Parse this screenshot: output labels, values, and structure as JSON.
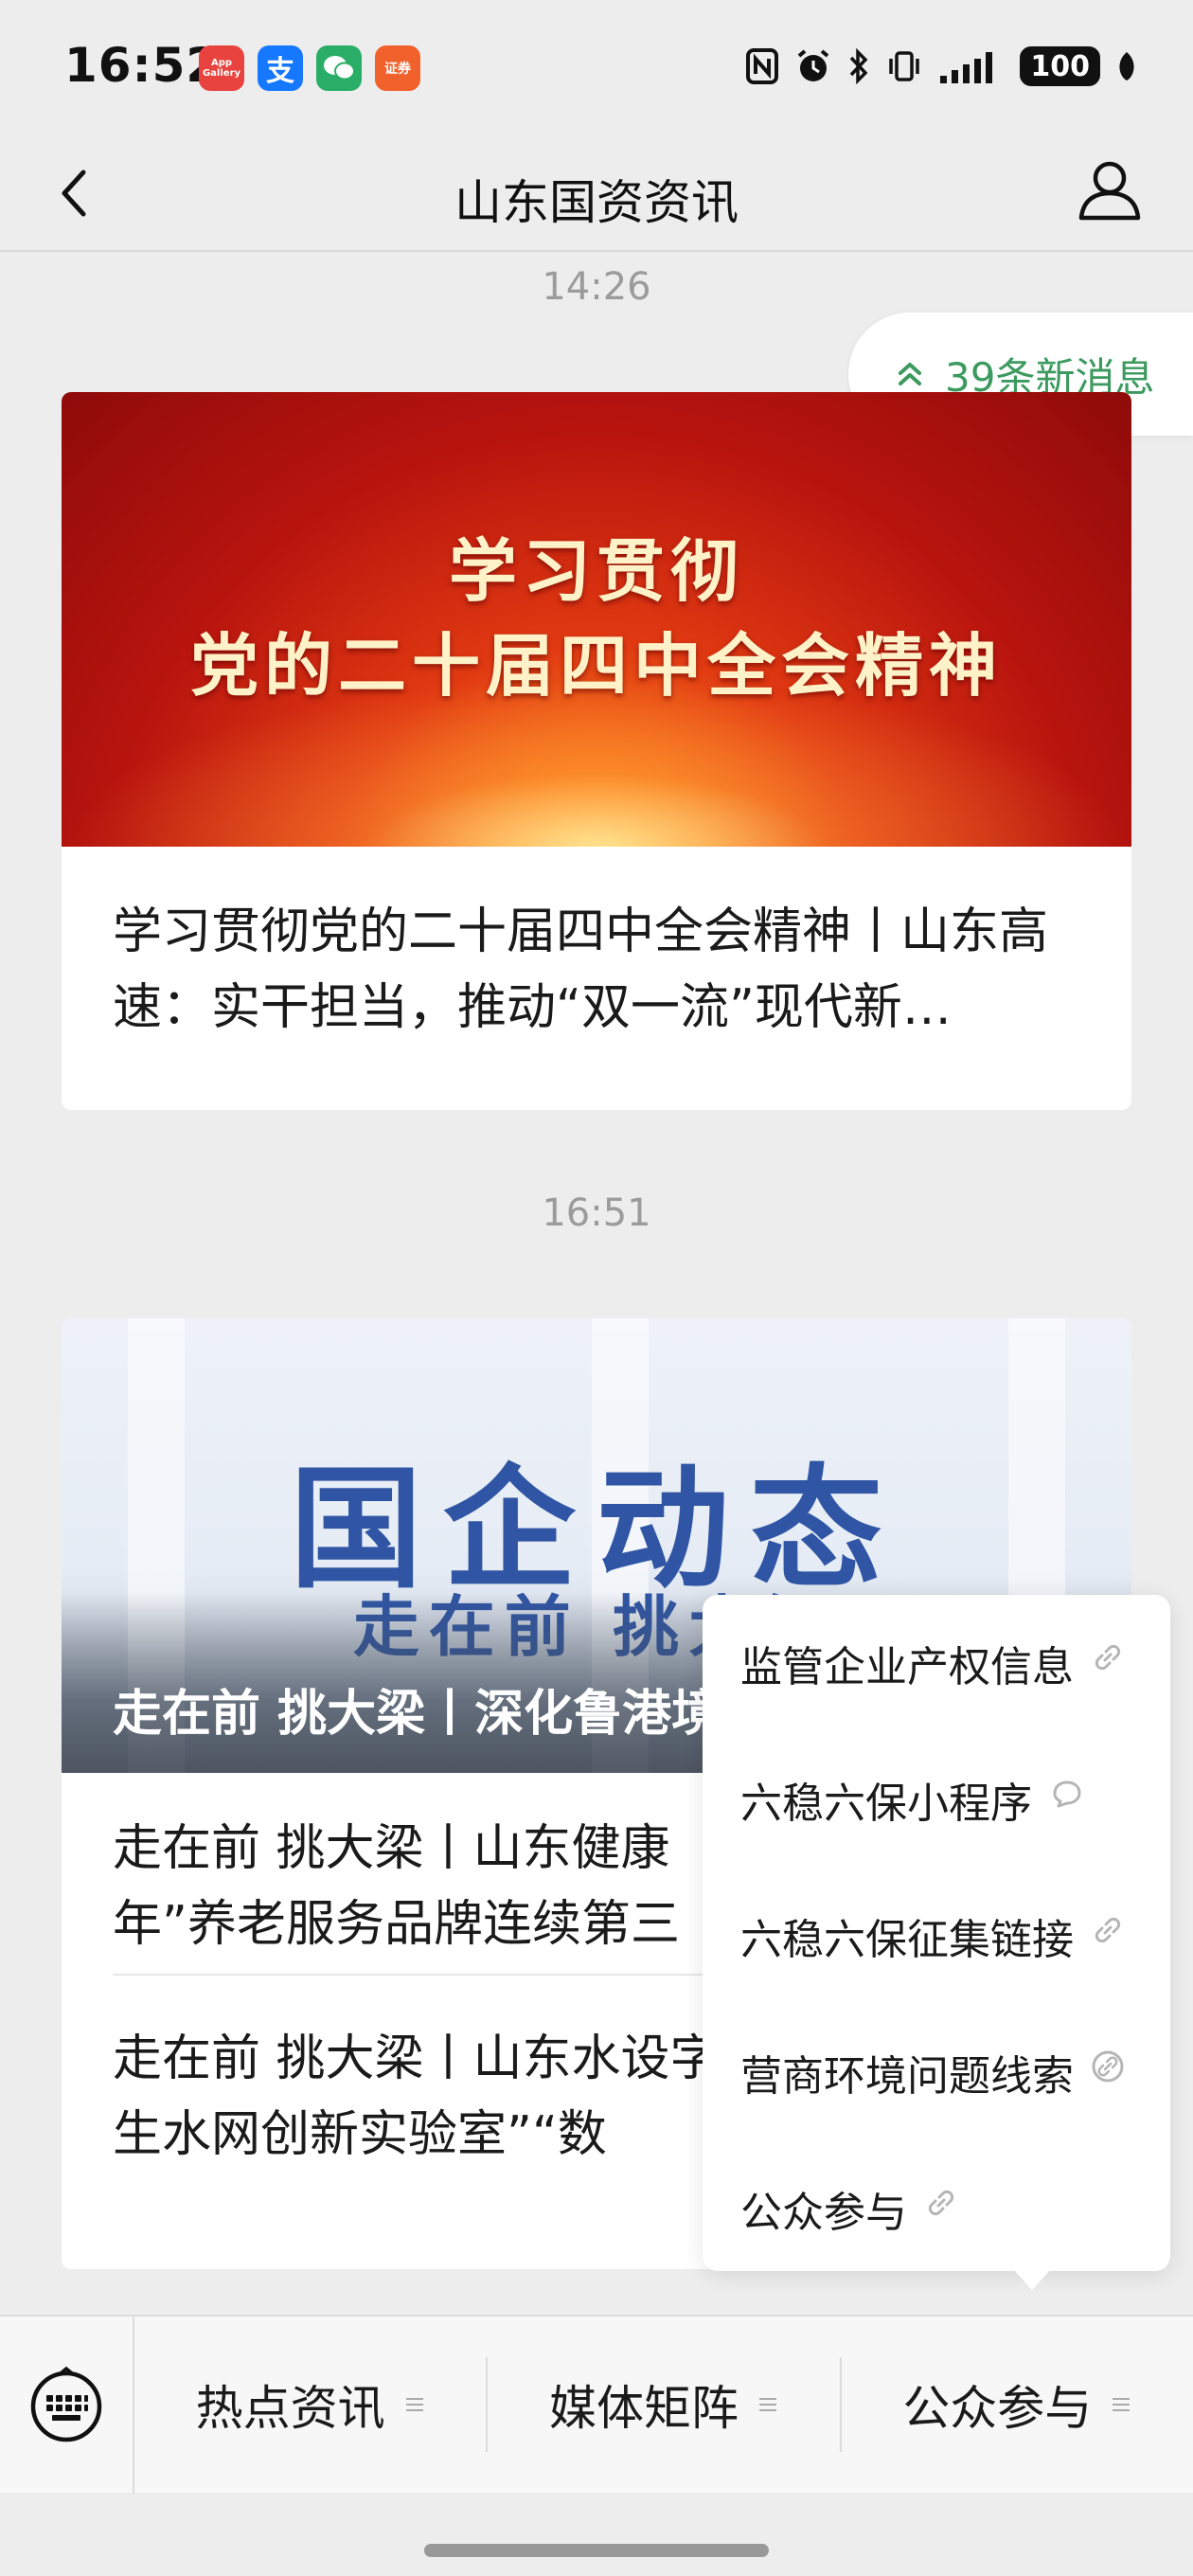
{
  "status_bar": {
    "time": "16:52",
    "apps": [
      {
        "name": "app-gallery-icon",
        "label": "App Gallery",
        "color": "#e8433e"
      },
      {
        "name": "alipay-icon",
        "label": "支",
        "color": "#1677ff"
      },
      {
        "name": "wechat-icon",
        "label": "",
        "color": "#2aae67"
      },
      {
        "name": "securities-icon",
        "label": "证券",
        "color": "#f0612c"
      }
    ],
    "battery": "100"
  },
  "nav": {
    "title": "山东国资资讯"
  },
  "chat": {
    "time_1": "14:26",
    "new_messages": "39条新消息",
    "article_1": {
      "banner_line_1": "学习贯彻",
      "banner_line_2": "党的二十届四中全会精神",
      "title": "学习贯彻党的二十届四中全会精神丨山东高速：实干担当，推动“双一流”现代新…"
    },
    "time_2": "16:51",
    "article_2": {
      "banner_big": "国企动态",
      "banner_sub": "走在前 挑大梁",
      "caption": "走在前 挑大梁丨深化鲁港境游新蓝海",
      "items": [
        {
          "title": "走在前 挑大梁丨山东健康年”养老服务品牌连续第三"
        },
        {
          "title": "走在前 挑大梁丨山东水设字孪生水网创新实验室”“数"
        }
      ]
    }
  },
  "popup_menu": {
    "items": [
      {
        "label": "监管企业产权信息",
        "icon": "link-icon"
      },
      {
        "label": "六稳六保小程序",
        "icon": "mini-program-icon"
      },
      {
        "label": "六稳六保征集链接",
        "icon": "link-icon"
      },
      {
        "label": "营商环境问题线索",
        "icon": "link-circle-icon"
      },
      {
        "label": "公众参与",
        "icon": "link-icon"
      }
    ]
  },
  "menu_bar": {
    "items": [
      {
        "label": "热点资讯"
      },
      {
        "label": "媒体矩阵"
      },
      {
        "label": "公众参与"
      }
    ]
  },
  "colors": {
    "accent_green": "#3c9a5f",
    "background": "#ededed"
  }
}
